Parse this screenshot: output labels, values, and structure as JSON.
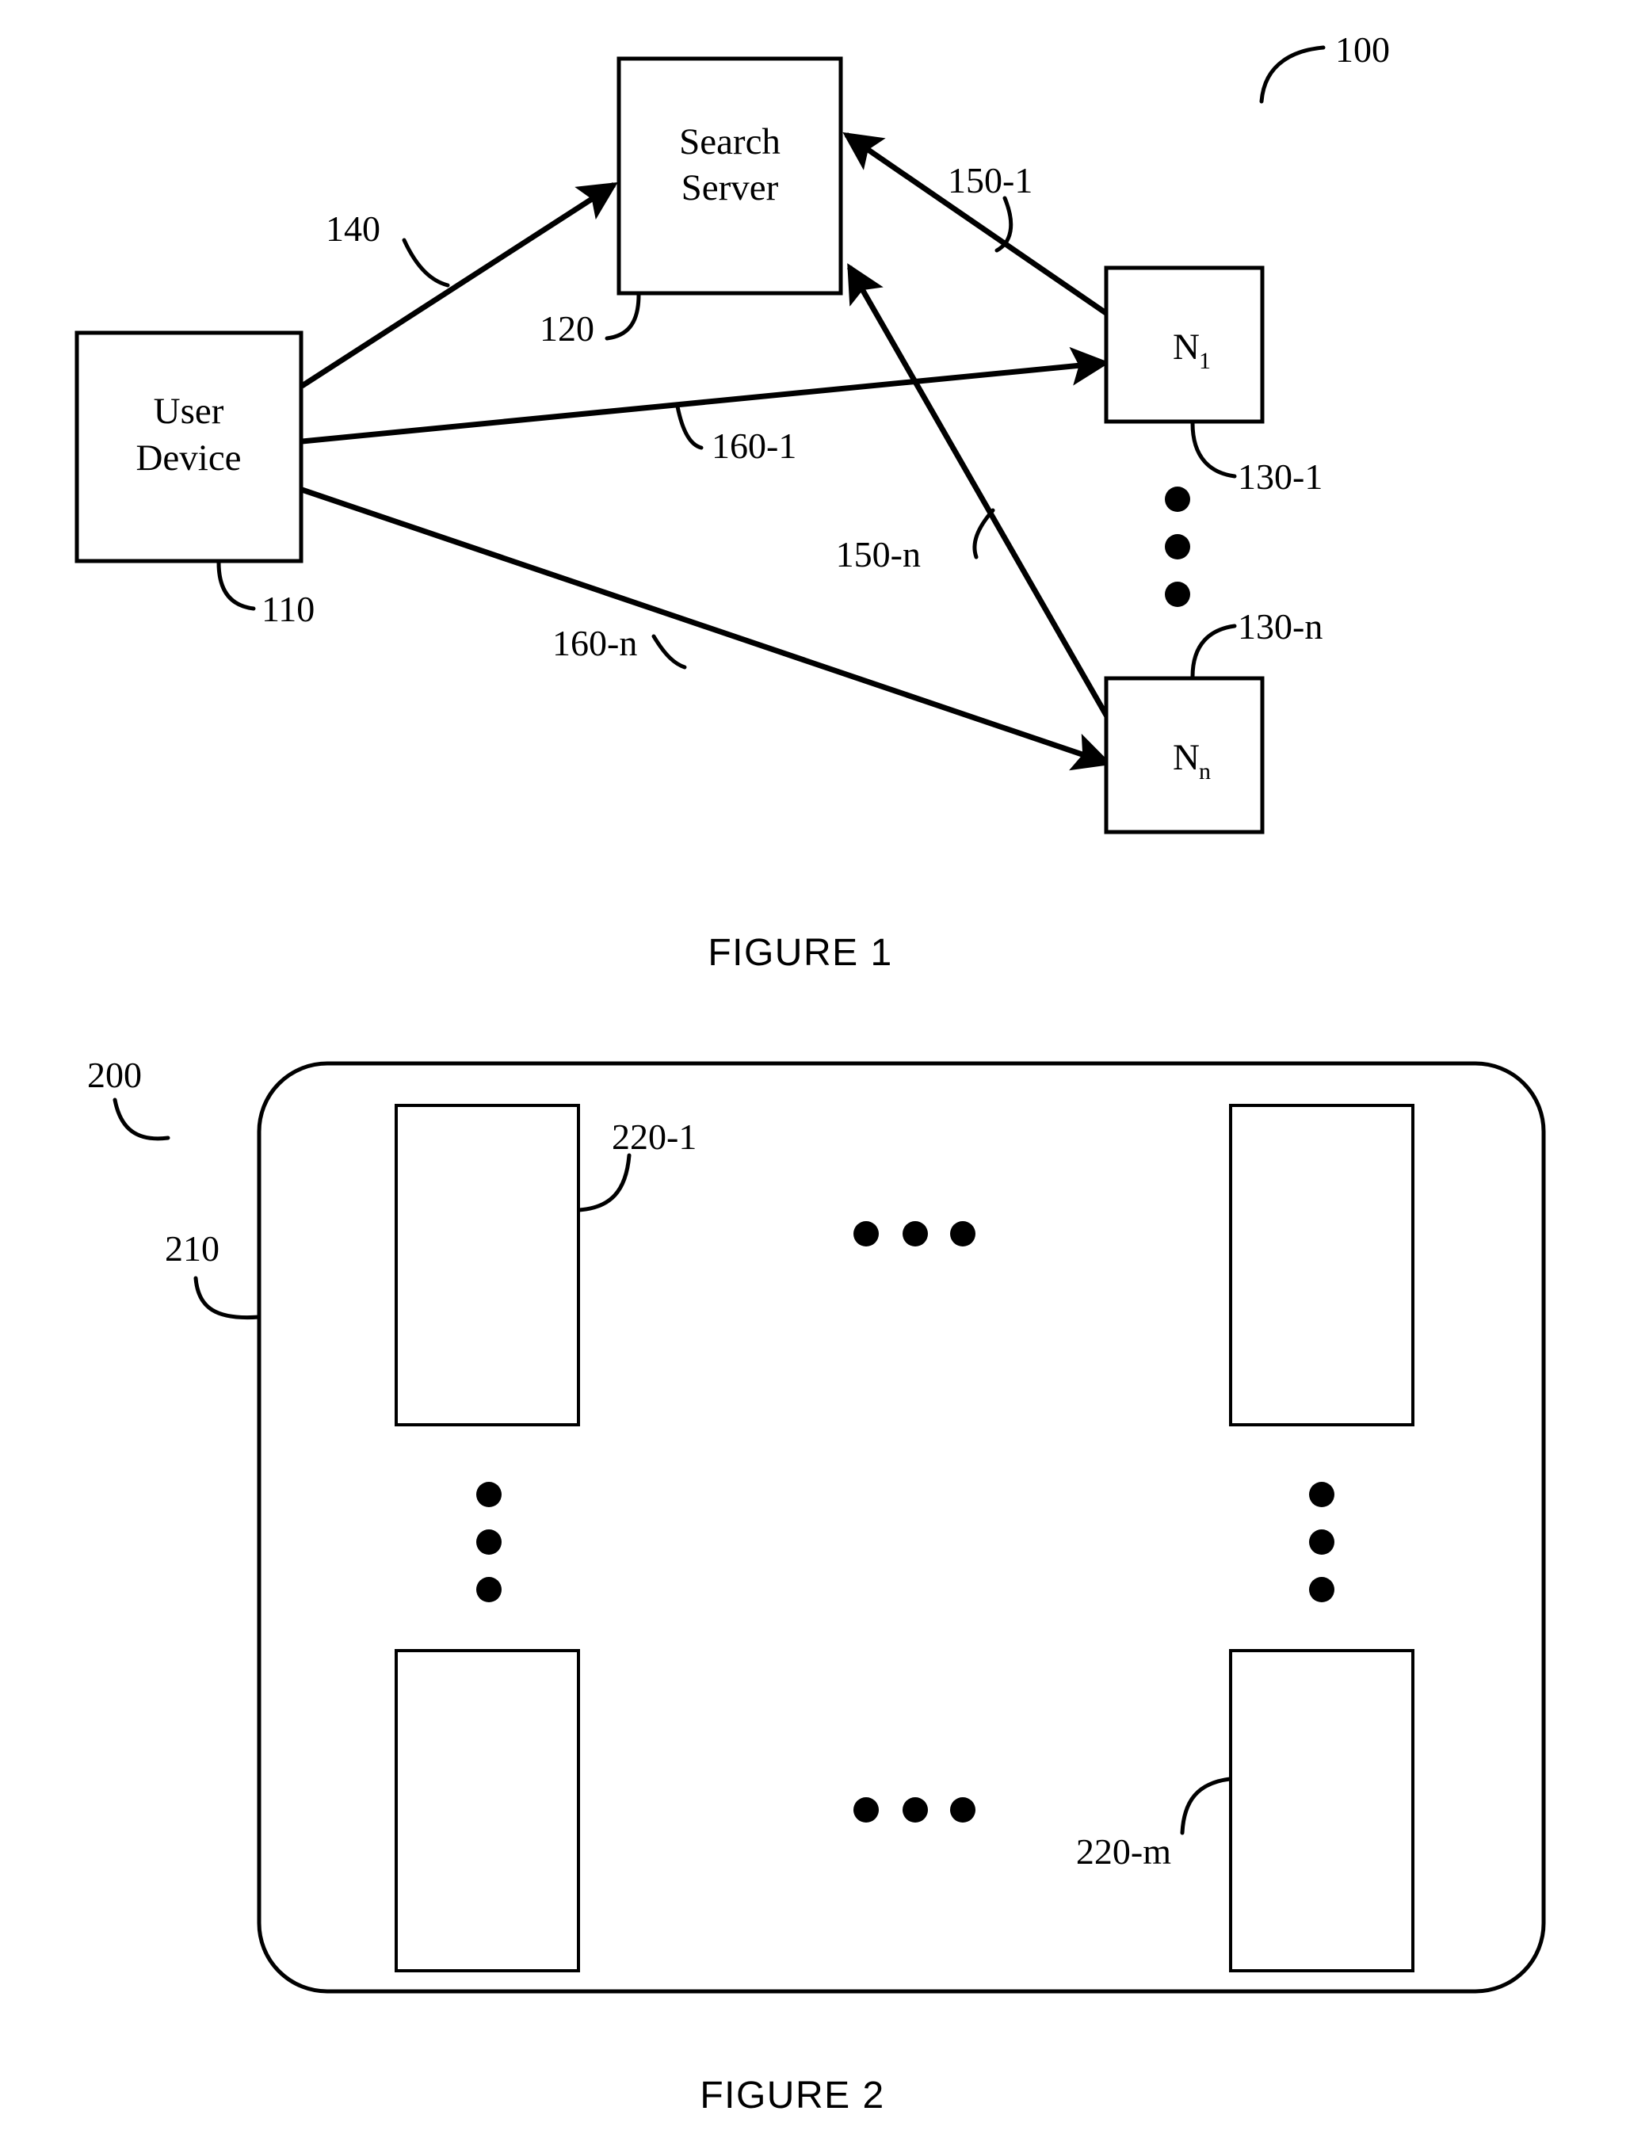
{
  "figure1": {
    "caption": "FIGURE 1",
    "system_ref": "100",
    "nodes": {
      "user_device": {
        "label_line1": "User",
        "label_line2": "Device",
        "ref": "110"
      },
      "search_server": {
        "label_line1": "Search",
        "label_line2": "Server",
        "ref": "120"
      },
      "node_first": {
        "label": "N",
        "subscript": "1",
        "ref": "130-1"
      },
      "node_last": {
        "label": "N",
        "subscript": "n",
        "ref": "130-n"
      }
    },
    "connections": [
      {
        "ref": "140",
        "from": "user-device",
        "to": "search-server"
      },
      {
        "ref": "150-1",
        "from": "node-1",
        "to": "search-server"
      },
      {
        "ref": "150-n",
        "from": "node-n",
        "to": "search-server"
      },
      {
        "ref": "160-1",
        "from": "user-device",
        "to": "node-1"
      },
      {
        "ref": "160-n",
        "from": "user-device",
        "to": "node-n"
      }
    ],
    "vertical_ellipsis_dots": 3
  },
  "figure2": {
    "caption": "FIGURE 2",
    "system_ref": "200",
    "container_ref": "210",
    "module_first_ref": "220-1",
    "module_last_ref": "220-m",
    "modules": 4,
    "horizontal_ellipsis_groups": 2,
    "vertical_ellipsis_groups": 2,
    "dots_per_group": 3
  },
  "colors": {
    "ink": "#000000",
    "paper": "#ffffff"
  }
}
